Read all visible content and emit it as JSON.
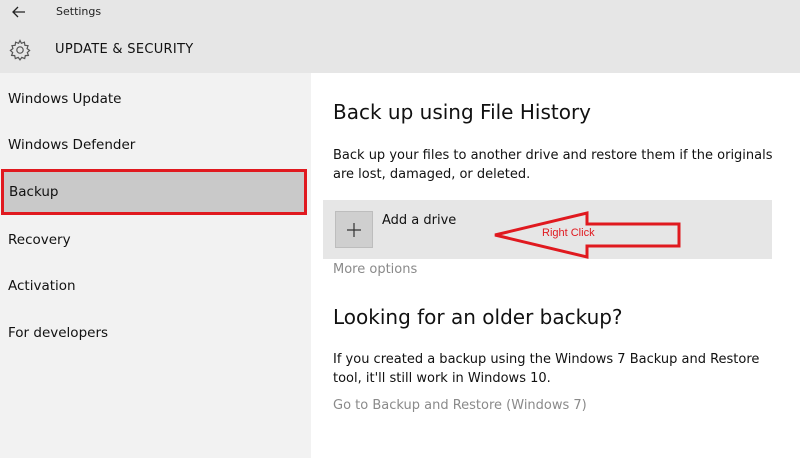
{
  "window": {
    "title": "Settings"
  },
  "section": {
    "title": "UPDATE & SECURITY"
  },
  "sidebar": {
    "items": [
      {
        "label": "Windows Update"
      },
      {
        "label": "Windows Defender"
      },
      {
        "label": "Backup"
      },
      {
        "label": "Recovery"
      },
      {
        "label": "Activation"
      },
      {
        "label": "For developers"
      }
    ],
    "selected": "Backup"
  },
  "main": {
    "file_history": {
      "heading": "Back up using File History",
      "description": "Back up your files to another drive and restore them if the originals are lost, damaged, or deleted.",
      "add_drive_label": "Add a drive",
      "more_options": "More options"
    },
    "older_backup": {
      "heading": "Looking for an older backup?",
      "description": "If you created a backup using the Windows 7 Backup and Restore tool, it'll still work in Windows 10.",
      "link": "Go to Backup and Restore (Windows 7)"
    }
  },
  "annotation": {
    "text": "Right Click",
    "color": "#e0191f"
  },
  "colors": {
    "header_bg": "#e6e6e6",
    "sidebar_bg": "#f2f2f2",
    "selected_bg": "#c9c9c9",
    "highlight_red": "#e0191f",
    "link_gray": "#8a8a8a"
  },
  "icons": {
    "back": "arrow-left-icon",
    "section": "gear-icon",
    "add": "plus-icon"
  }
}
